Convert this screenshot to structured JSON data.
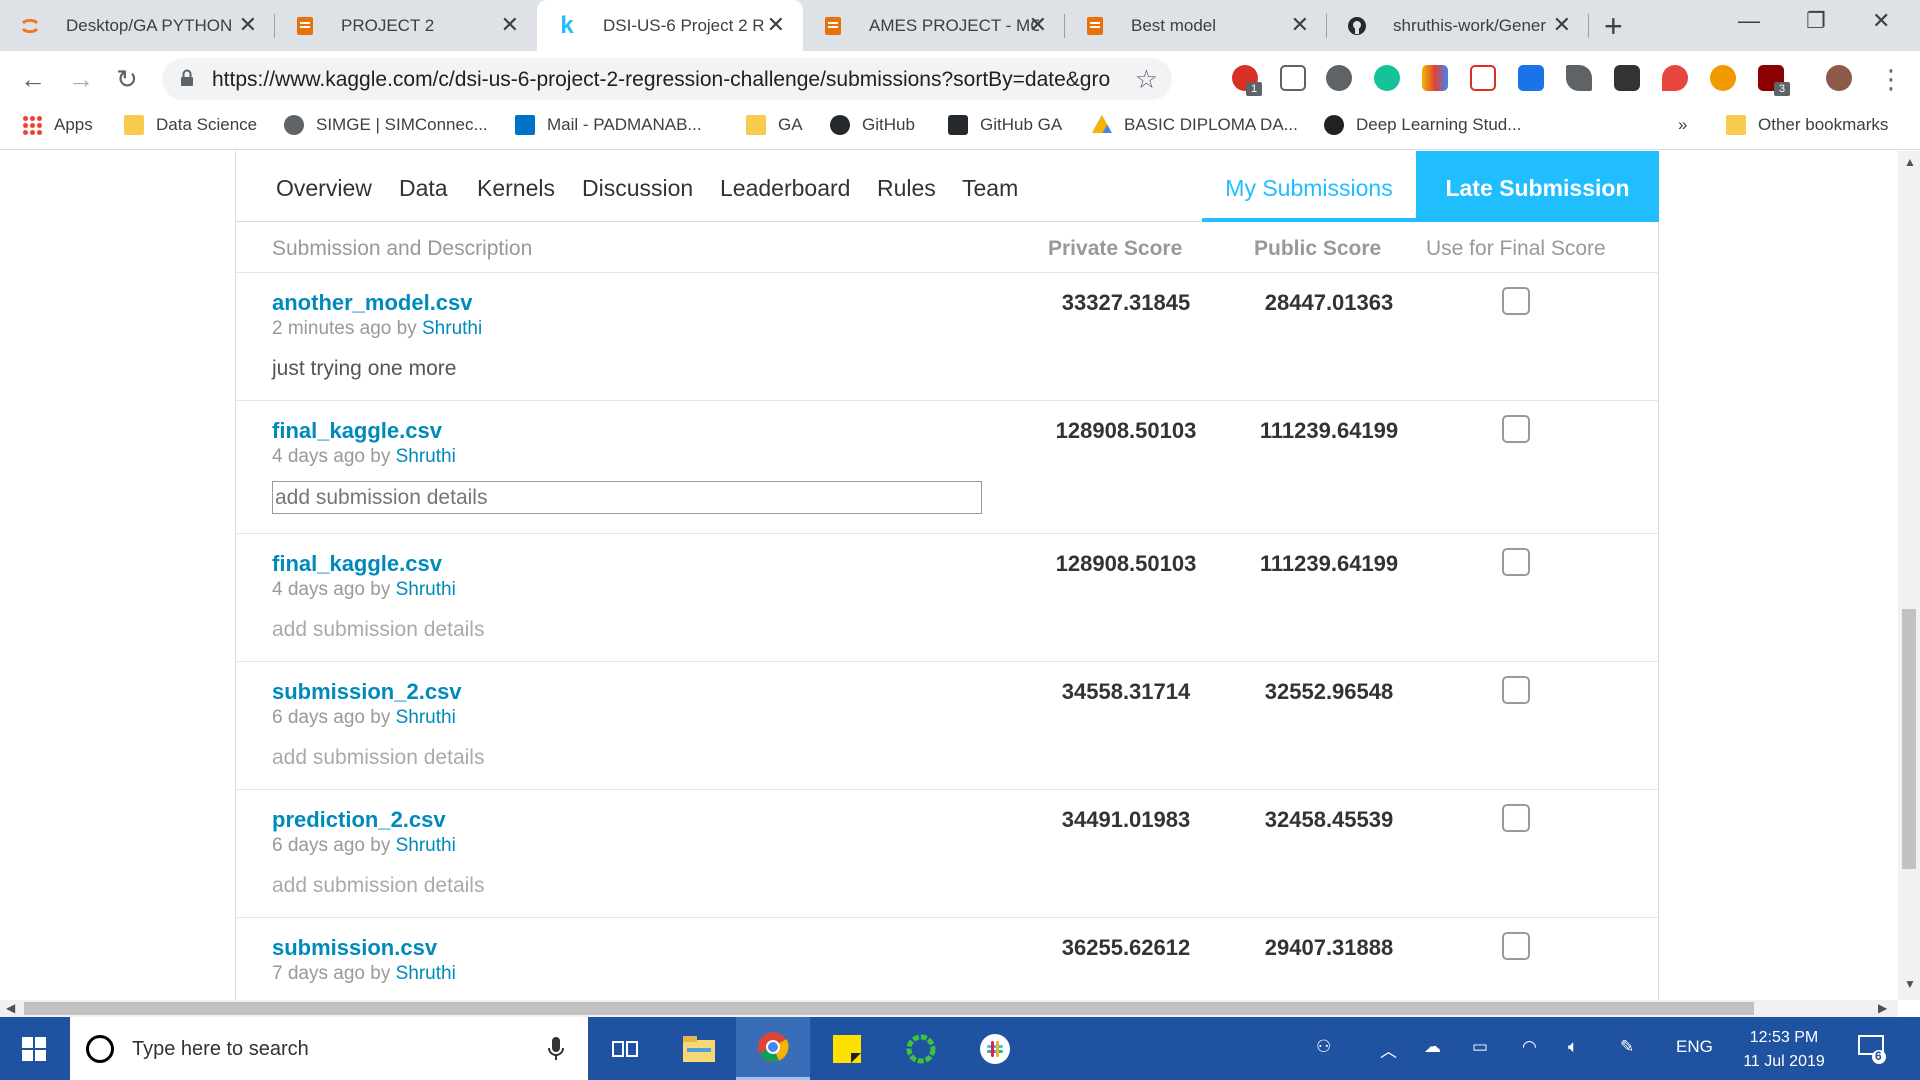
{
  "browser": {
    "tabs": [
      {
        "title": "Desktop/GA PYTHON",
        "favicon": "jupyter-icon",
        "color": "#f37626"
      },
      {
        "title": "PROJECT 2",
        "favicon": "doc-icon",
        "color": "#e8710a"
      },
      {
        "title": "DSI-US-6 Project 2 R",
        "favicon": "kaggle-icon",
        "color": "#20beff"
      },
      {
        "title": "AMES PROJECT - MC",
        "favicon": "doc-icon",
        "color": "#e8710a"
      },
      {
        "title": "Best model",
        "favicon": "doc-icon",
        "color": "#e8710a"
      },
      {
        "title": "shruthis-work/Gener",
        "favicon": "github-icon",
        "color": "#24292e"
      }
    ],
    "url": "https://www.kaggle.com/c/dsi-us-6-project-2-regression-challenge/submissions?sortBy=date&gro...",
    "extension_badges": {
      "first": "1",
      "last": "3"
    },
    "bookmarks": [
      {
        "label": "Apps",
        "icon": "apps-grid-icon"
      },
      {
        "label": "Data Science",
        "icon": "folder-icon"
      },
      {
        "label": "SIMGE | SIMConnec...",
        "icon": "globe-icon"
      },
      {
        "label": "Mail - PADMANAB...",
        "icon": "outlook-icon"
      },
      {
        "label": "GA",
        "icon": "folder-icon"
      },
      {
        "label": "GitHub",
        "icon": "github-icon"
      },
      {
        "label": "GitHub GA",
        "icon": "github-icon"
      },
      {
        "label": "BASIC DIPLOMA DA...",
        "icon": "drive-icon"
      },
      {
        "label": "Deep Learning Stud...",
        "icon": "deep-learning-icon"
      }
    ],
    "bookmarks_overflow": "»",
    "other_bookmarks": "Other bookmarks"
  },
  "competition_nav": {
    "tabs": [
      "Overview",
      "Data",
      "Kernels",
      "Discussion",
      "Leaderboard",
      "Rules",
      "Team"
    ],
    "my_submissions": "My Submissions",
    "late_submission": "Late Submission"
  },
  "table": {
    "headers": {
      "description": "Submission and Description",
      "private": "Private Score",
      "public": "Public Score",
      "final": "Use for Final Score"
    },
    "by_word": "by",
    "rows": [
      {
        "file": "another_model.csv",
        "ago": "2 minutes ago",
        "user": "Shruthi",
        "desc": "just trying one more",
        "desc_type": "text",
        "private": "33327.31845",
        "public": "28447.01363",
        "final": false
      },
      {
        "file": "final_kaggle.csv",
        "ago": "4 days ago",
        "user": "Shruthi",
        "desc": "add submission details",
        "desc_type": "input",
        "private": "128908.50103",
        "public": "111239.64199",
        "final": false
      },
      {
        "file": "final_kaggle.csv",
        "ago": "4 days ago",
        "user": "Shruthi",
        "desc": "add submission details",
        "desc_type": "placeholder",
        "private": "128908.50103",
        "public": "111239.64199",
        "final": false
      },
      {
        "file": "submission_2.csv",
        "ago": "6 days ago",
        "user": "Shruthi",
        "desc": "add submission details",
        "desc_type": "placeholder",
        "private": "34558.31714",
        "public": "32552.96548",
        "final": false
      },
      {
        "file": "prediction_2.csv",
        "ago": "6 days ago",
        "user": "Shruthi",
        "desc": "add submission details",
        "desc_type": "placeholder",
        "private": "34491.01983",
        "public": "32458.45539",
        "final": false
      },
      {
        "file": "submission.csv",
        "ago": "7 days ago",
        "user": "Shruthi",
        "desc": "",
        "desc_type": "none",
        "private": "36255.62612",
        "public": "29407.31888",
        "final": false
      }
    ]
  },
  "taskbar": {
    "search_placeholder": "Type here to search",
    "language": "ENG",
    "time": "12:53 PM",
    "date": "11 Jul 2019",
    "notification_count": "6"
  },
  "colors": {
    "kaggle_blue": "#20beff",
    "link_blue": "#008abc",
    "taskbar": "#1f52a0"
  }
}
